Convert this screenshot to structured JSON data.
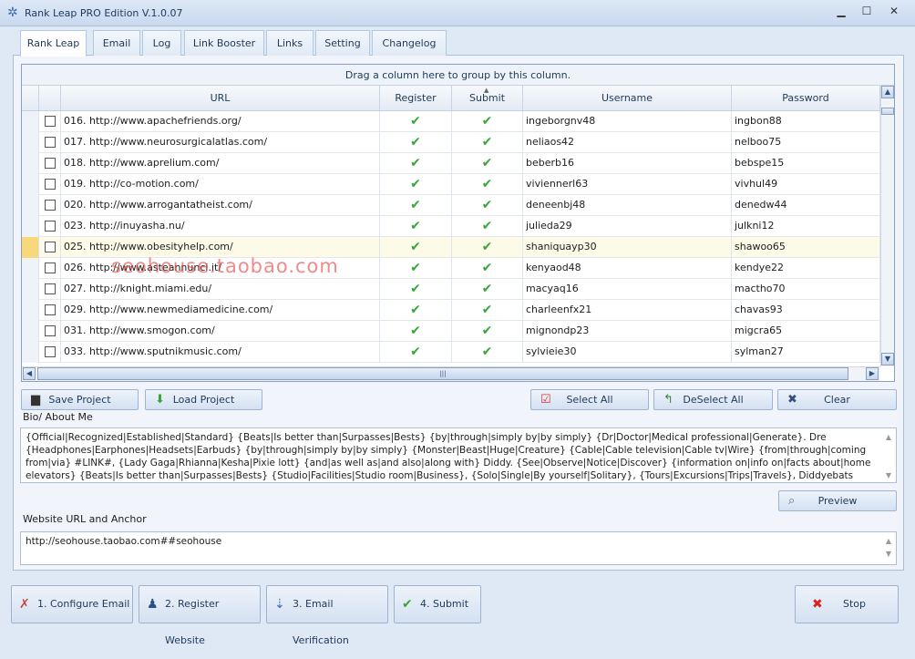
{
  "window": {
    "title": "Rank Leap PRO Edition V.1.0.07",
    "minimize": "▁",
    "maximize": "☐",
    "close": "✕"
  },
  "tabs": [
    {
      "label": "Rank Leap",
      "active": true
    },
    {
      "label": "Email"
    },
    {
      "label": "Log"
    },
    {
      "label": "Link Booster"
    },
    {
      "label": "Links"
    },
    {
      "label": "Setting"
    },
    {
      "label": "Changelog"
    }
  ],
  "grid": {
    "group_hint": "Drag a column here to group by this column.",
    "columns": [
      "URL",
      "Register",
      "Submit",
      "Username",
      "Password"
    ],
    "sorted_column": "Submit",
    "rows": [
      {
        "url": "016. http://www.apachefriends.org/",
        "register": true,
        "submit": true,
        "username": "ingeborgnv48",
        "password": "ingbon88"
      },
      {
        "url": "017. http://www.neurosurgicalatlas.com/",
        "register": true,
        "submit": true,
        "username": "neliaos42",
        "password": "nelboo75"
      },
      {
        "url": "018. http://www.aprelium.com/",
        "register": true,
        "submit": true,
        "username": "beberb16",
        "password": "bebspe15"
      },
      {
        "url": "019. http://co-motion.com/",
        "register": true,
        "submit": true,
        "username": "viviennerl63",
        "password": "vivhul49"
      },
      {
        "url": "020. http://www.arrogantatheist.com/",
        "register": true,
        "submit": true,
        "username": "deneenbj48",
        "password": "denedw44"
      },
      {
        "url": "023. http://inuyasha.nu/",
        "register": true,
        "submit": true,
        "username": "julieda29",
        "password": "julkni12"
      },
      {
        "url": "025. http://www.obesityhelp.com/",
        "register": true,
        "submit": true,
        "username": "shaniquayp30",
        "password": "shawoo65",
        "selected": true
      },
      {
        "url": "026. http://www.asteannunci.it/",
        "register": true,
        "submit": true,
        "username": "kenyaod48",
        "password": "kendye22"
      },
      {
        "url": "027. http://knight.miami.edu/",
        "register": true,
        "submit": true,
        "username": "macyaq16",
        "password": "mactho70"
      },
      {
        "url": "029. http://www.newmediamedicine.com/",
        "register": true,
        "submit": true,
        "username": "charleenfx21",
        "password": "chavas93"
      },
      {
        "url": "031. http://www.smogon.com/",
        "register": true,
        "submit": true,
        "username": "mignondp23",
        "password": "migcra65"
      },
      {
        "url": "033. http://www.sputnikmusic.com/",
        "register": true,
        "submit": true,
        "username": "sylvieie30",
        "password": "sylman27"
      }
    ]
  },
  "buttons": {
    "save_project": "Save Project",
    "load_project": "Load Project",
    "select_all": "Select All",
    "deselect_all": "DeSelect All",
    "clear": "Clear",
    "preview": "Preview"
  },
  "bio": {
    "label": "Bio/ About Me",
    "value": "{Official|Recognized|Established|Standard} {Beats|Is better than|Surpasses|Bests} {by|through|simply by|by simply} {Dr|Doctor|Medical professional|Generate}. Dre {Headphones|Earphones|Headsets|Earbuds} {by|through|simply by|by simply} {Monster|Beast|Huge|Creature} {Cable|Cable television|Cable tv|Wire} {from|through|coming from|via} #LINK#, {Lady Gaga|Rhianna|Kesha|Pixie lott} {and|as well as|and also|along with} Diddy. {See|Observe|Notice|Discover} {information on|info on|facts about|home elevators} {Beats|Is better than|Surpasses|Bests} {Studio|Facilities|Studio room|Business}, {Solo|Single|By yourself|Solitary}, {Tours|Excursions|Trips|Travels}, Diddyebats"
  },
  "website": {
    "label": "Website URL and Anchor",
    "value": "http://seohouse.taobao.com##seohouse"
  },
  "steps": {
    "configure_email": "1. Configure Email",
    "register_website": "2. Register Website",
    "email_verification": "3. Email Verification",
    "submit": "4. Submit",
    "stop": "Stop"
  },
  "watermark": "seohouse.taobao.com",
  "colors": {
    "check": "#3aa53a",
    "selected_row": "#fdfae8",
    "accent": "#1e395b"
  }
}
